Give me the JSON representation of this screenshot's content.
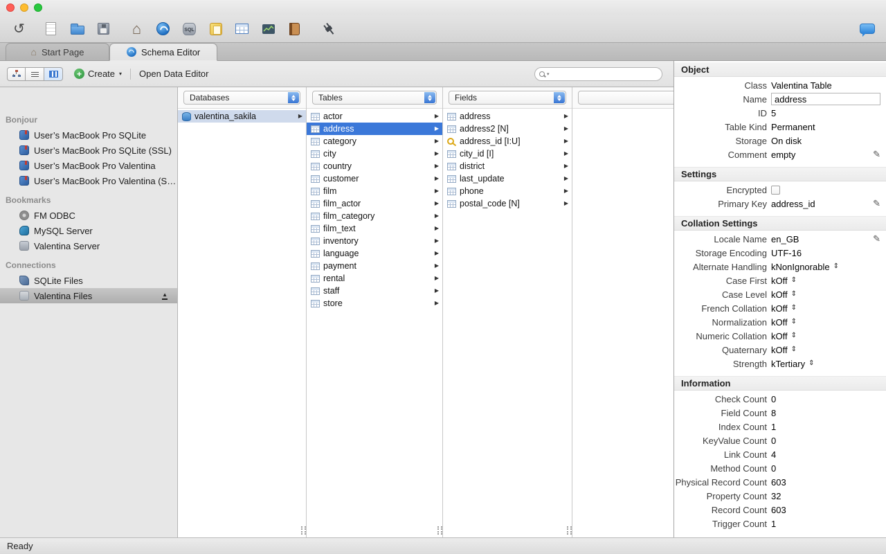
{
  "icons": {
    "undo-icon": "↺",
    "home-icon": "⌂",
    "plus-icon": "+",
    "dropdown-caret-icon": "▾",
    "disclosure-arrow-icon": "▶",
    "edit-pencil-icon": "✎",
    "updown-arrows-icon": "⇕",
    "eject-icon": "▲"
  },
  "toolbar": {
    "sql_badge": "SQL"
  },
  "tabs": [
    {
      "label": "Start Page"
    },
    {
      "label": "Schema Editor"
    }
  ],
  "actionbar": {
    "create_label": "Create",
    "open_data_editor_label": "Open Data Editor",
    "search_placeholder": ""
  },
  "sidebar": {
    "sections": [
      {
        "title": "Bonjour",
        "items": [
          {
            "label": "User’s MacBook Pro SQLite",
            "icon": "bonjour-book-icon"
          },
          {
            "label": "User’s MacBook Pro SQLite (SSL)",
            "icon": "bonjour-book-icon"
          },
          {
            "label": "User’s MacBook Pro Valentina",
            "icon": "bonjour-book-icon"
          },
          {
            "label": "User’s MacBook Pro Valentina (S…",
            "icon": "bonjour-book-icon"
          }
        ]
      },
      {
        "title": "Bookmarks",
        "items": [
          {
            "label": "FM ODBC",
            "icon": "odbc-icon"
          },
          {
            "label": "MySQL Server",
            "icon": "mysql-icon"
          },
          {
            "label": "Valentina Server",
            "icon": "valentina-server-icon"
          }
        ]
      },
      {
        "title": "Connections",
        "items": [
          {
            "label": "SQLite Files",
            "icon": "sqlite-files-icon"
          },
          {
            "label": "Valentina Files",
            "icon": "valentina-files-icon",
            "selected": true,
            "eject": true
          }
        ]
      }
    ]
  },
  "columns": {
    "databases": {
      "header": "Databases",
      "items": [
        {
          "label": "valentina_sakila",
          "icon": "database-icon",
          "selected": true
        }
      ]
    },
    "tables": {
      "header": "Tables",
      "items": [
        {
          "label": "actor"
        },
        {
          "label": "address",
          "selected": true
        },
        {
          "label": "category"
        },
        {
          "label": "city"
        },
        {
          "label": "country"
        },
        {
          "label": "customer"
        },
        {
          "label": "film"
        },
        {
          "label": "film_actor"
        },
        {
          "label": "film_category"
        },
        {
          "label": "film_text"
        },
        {
          "label": "inventory"
        },
        {
          "label": "language"
        },
        {
          "label": "payment"
        },
        {
          "label": "rental"
        },
        {
          "label": "staff"
        },
        {
          "label": "store"
        }
      ]
    },
    "fields": {
      "header": "Fields",
      "items": [
        {
          "label": "address"
        },
        {
          "label": "address2 [N]"
        },
        {
          "label": "address_id [I:U]",
          "icon": "key-icon"
        },
        {
          "label": "city_id [I]"
        },
        {
          "label": "district"
        },
        {
          "label": "last_update"
        },
        {
          "label": "phone"
        },
        {
          "label": "postal_code [N]"
        }
      ]
    },
    "extra": {
      "header": ""
    }
  },
  "inspector": {
    "sections": [
      {
        "title": "Object",
        "rows": [
          {
            "label": "Class",
            "value": "Valentina Table"
          },
          {
            "label": "Name",
            "value": "address",
            "control": "input"
          },
          {
            "label": "ID",
            "value": "5"
          },
          {
            "label": "Table Kind",
            "value": "Permanent"
          },
          {
            "label": "Storage",
            "value": "On disk"
          },
          {
            "label": "Comment",
            "value": "empty",
            "edit": true
          }
        ]
      },
      {
        "title": "Settings",
        "rows": [
          {
            "label": "Encrypted",
            "control": "checkbox"
          },
          {
            "label": "Primary Key",
            "value": "address_id",
            "edit": true
          }
        ]
      },
      {
        "title": "Collation Settings",
        "rows": [
          {
            "label": "Locale Name",
            "value": "en_GB",
            "edit": true
          },
          {
            "label": "Storage Encoding",
            "value": "UTF-16"
          },
          {
            "label": "Alternate Handling",
            "value": "kNonIgnorable",
            "control": "dropdown"
          },
          {
            "label": "Case First",
            "value": "kOff",
            "control": "dropdown"
          },
          {
            "label": "Case Level",
            "value": "kOff",
            "control": "dropdown"
          },
          {
            "label": "French Collation",
            "value": "kOff",
            "control": "dropdown"
          },
          {
            "label": "Normalization",
            "value": "kOff",
            "control": "dropdown"
          },
          {
            "label": "Numeric Collation",
            "value": "kOff",
            "control": "dropdown"
          },
          {
            "label": "Quaternary",
            "value": "kOff",
            "control": "dropdown"
          },
          {
            "label": "Strength",
            "value": "kTertiary",
            "control": "dropdown"
          }
        ]
      },
      {
        "title": "Information",
        "rows": [
          {
            "label": "Check Count",
            "value": "0"
          },
          {
            "label": "Field Count",
            "value": "8"
          },
          {
            "label": "Index Count",
            "value": "1"
          },
          {
            "label": "KeyValue Count",
            "value": "0"
          },
          {
            "label": "Link Count",
            "value": "4"
          },
          {
            "label": "Method Count",
            "value": "0"
          },
          {
            "label": "Physical Record Count",
            "value": "603"
          },
          {
            "label": "Property Count",
            "value": "32"
          },
          {
            "label": "Record Count",
            "value": "603"
          },
          {
            "label": "Trigger Count",
            "value": "1"
          }
        ]
      }
    ]
  },
  "statusbar": {
    "text": "Ready"
  }
}
